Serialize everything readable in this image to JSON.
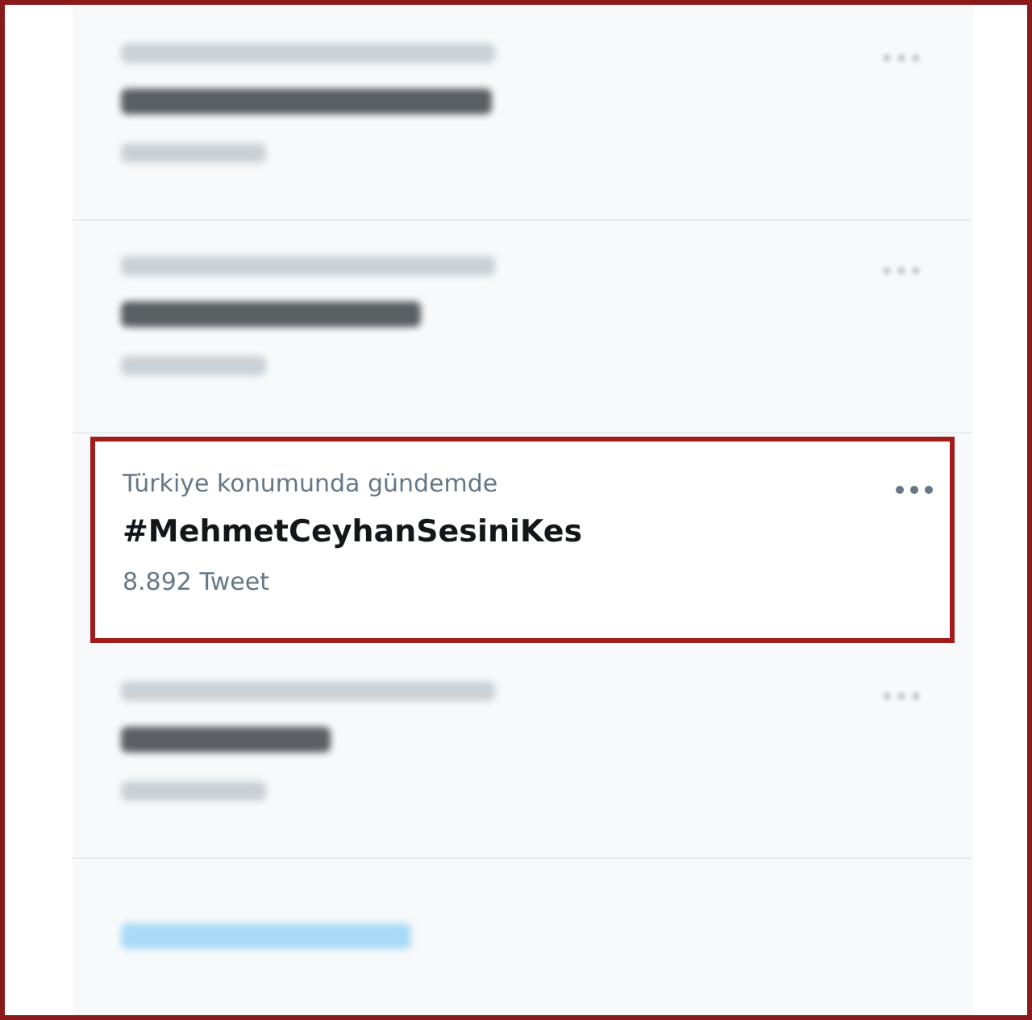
{
  "trends": [
    {
      "kind": "redacted"
    },
    {
      "kind": "redacted"
    },
    {
      "kind": "trend",
      "context": "Türkiye konumunda gündemde",
      "title": "#MehmetCeyhanSesiniKes",
      "count": "8.892 Tweet",
      "highlighted": true
    },
    {
      "kind": "redacted"
    }
  ],
  "show_more_redacted": true
}
